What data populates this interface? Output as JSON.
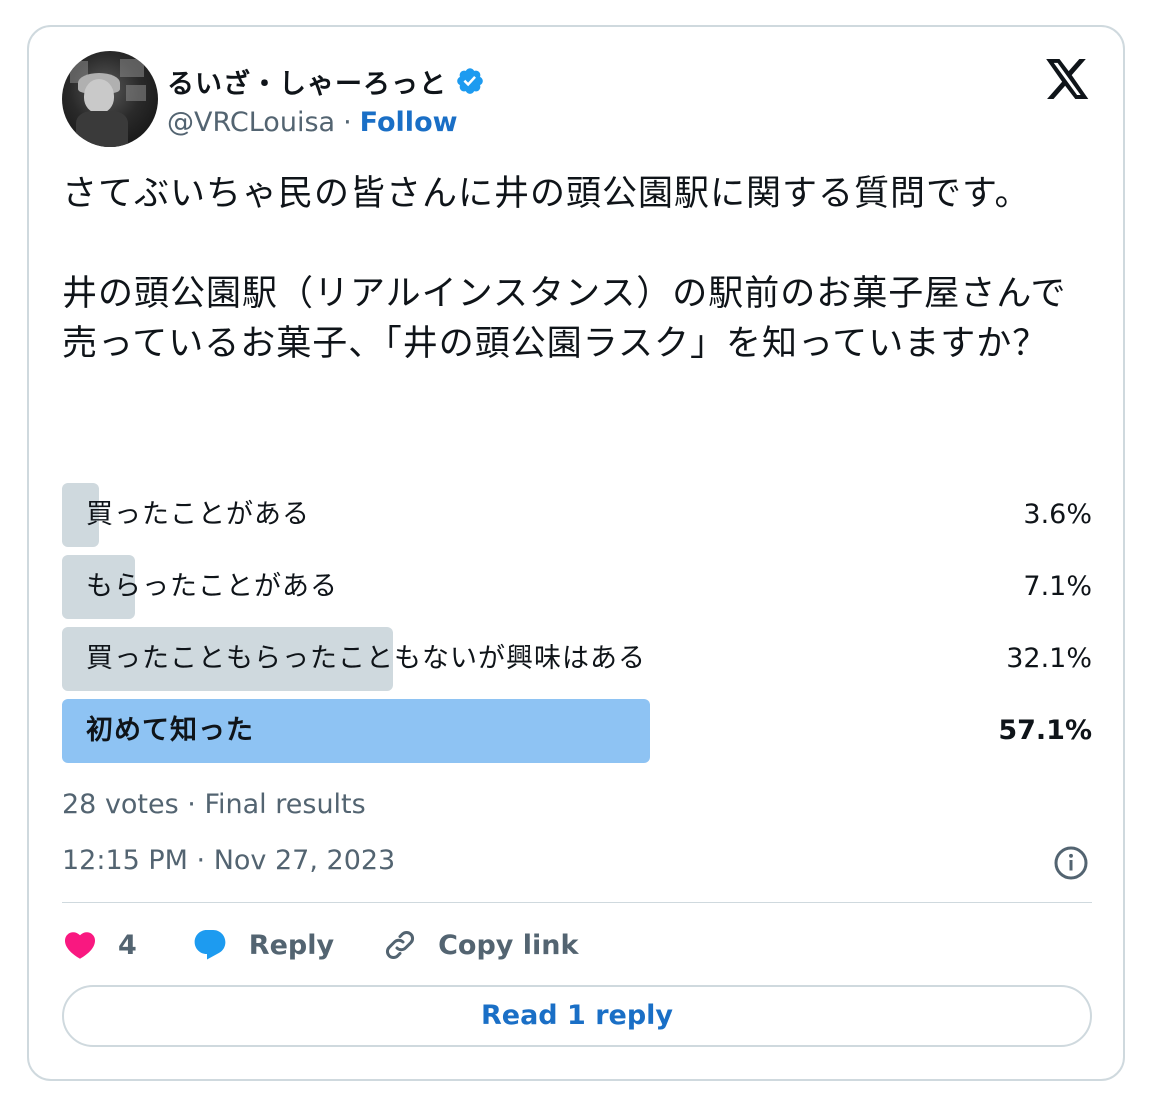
{
  "author": {
    "display_name": "るいざ・しゃーろっと",
    "handle": "@VRCLouisa",
    "separator": "·",
    "follow_label": "Follow",
    "verified_icon": "verified-badge-icon",
    "verified_color": "#1d9bf0"
  },
  "brand_icon": "x-logo-icon",
  "tweet_text": "さてぶいちゃ民の皆さんに井の頭公園駅に関する質問です。\n\n井の頭公園駅（リアルインスタンス）の駅前のお菓子屋さんで売っているお菓子、「井の頭公園ラスク」を知っていますか？",
  "poll": {
    "options": [
      {
        "label": "買ったことがある",
        "percent_text": "3.6%",
        "percent": 3.6,
        "winner": false
      },
      {
        "label": "もらったことがある",
        "percent_text": "7.1%",
        "percent": 7.1,
        "winner": false
      },
      {
        "label": "買ったこともらったこともないが興味はある",
        "percent_text": "32.1%",
        "percent": 32.1,
        "winner": false
      },
      {
        "label": "初めて知った",
        "percent_text": "57.1%",
        "percent": 57.1,
        "winner": true
      }
    ],
    "summary": "28 votes · Final results",
    "bar_color": "#cfd9de",
    "winner_color": "#8ec3f3"
  },
  "timestamp": "12:15 PM · Nov 27, 2023",
  "actions": {
    "like_count": "4",
    "reply_label": "Reply",
    "copy_link_label": "Copy link",
    "like_color": "#f91880",
    "reply_color": "#1d9bf0"
  },
  "read_replies_label": "Read 1 reply"
}
